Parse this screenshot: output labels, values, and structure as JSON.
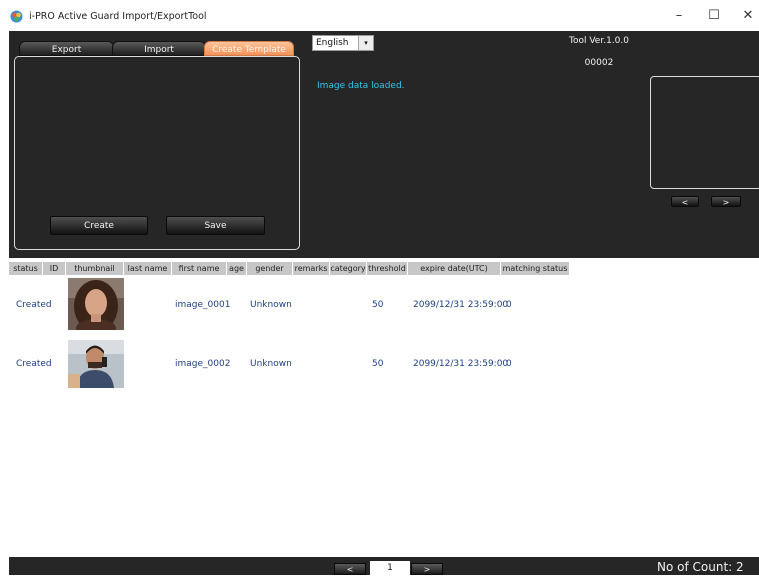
{
  "window": {
    "title": "i-PRO Active Guard Import/ExportTool",
    "minimize_glyph": "–",
    "maximize_glyph": "☐",
    "close_glyph": "✕"
  },
  "tabs": [
    {
      "label": "Export",
      "active": false
    },
    {
      "label": "Import",
      "active": false
    },
    {
      "label": "Create Template",
      "active": true
    }
  ],
  "template_panel": {
    "create_label": "Create",
    "save_label": "Save"
  },
  "language": {
    "selected": "English",
    "arrow_glyph": "▾"
  },
  "status_message": "Image data loaded.",
  "tool_version": "Tool Ver.1.0.0",
  "record_count": "00002",
  "preview_nav": {
    "prev_label": "<",
    "next_label": ">"
  },
  "table": {
    "columns": [
      "status",
      "ID",
      "thumbnail",
      "last name",
      "first name",
      "age",
      "gender",
      "remarks",
      "category",
      "threshold",
      "expire date(UTC)",
      "matching status"
    ],
    "rows": [
      {
        "status": "Created",
        "id": "",
        "last_name": "",
        "first_name": "image_0001",
        "age": "",
        "gender": "Unknown",
        "remarks": "",
        "category": "",
        "threshold": "50",
        "expire_date": "2099/12/31 23:59:00",
        "matching_status": "0"
      },
      {
        "status": "Created",
        "id": "",
        "last_name": "",
        "first_name": "image_0002",
        "age": "",
        "gender": "Unknown",
        "remarks": "",
        "category": "",
        "threshold": "50",
        "expire_date": "2099/12/31 23:59:00",
        "matching_status": "0"
      }
    ]
  },
  "pager": {
    "prev_label": "<",
    "page": "1",
    "next_label": ">"
  },
  "footer_count": "No of Count: 2",
  "colors": {
    "dark_bg": "#262626",
    "active_tab": "#f3935a",
    "status_text": "#2ec8ee",
    "row_text": "#1f3f86"
  }
}
